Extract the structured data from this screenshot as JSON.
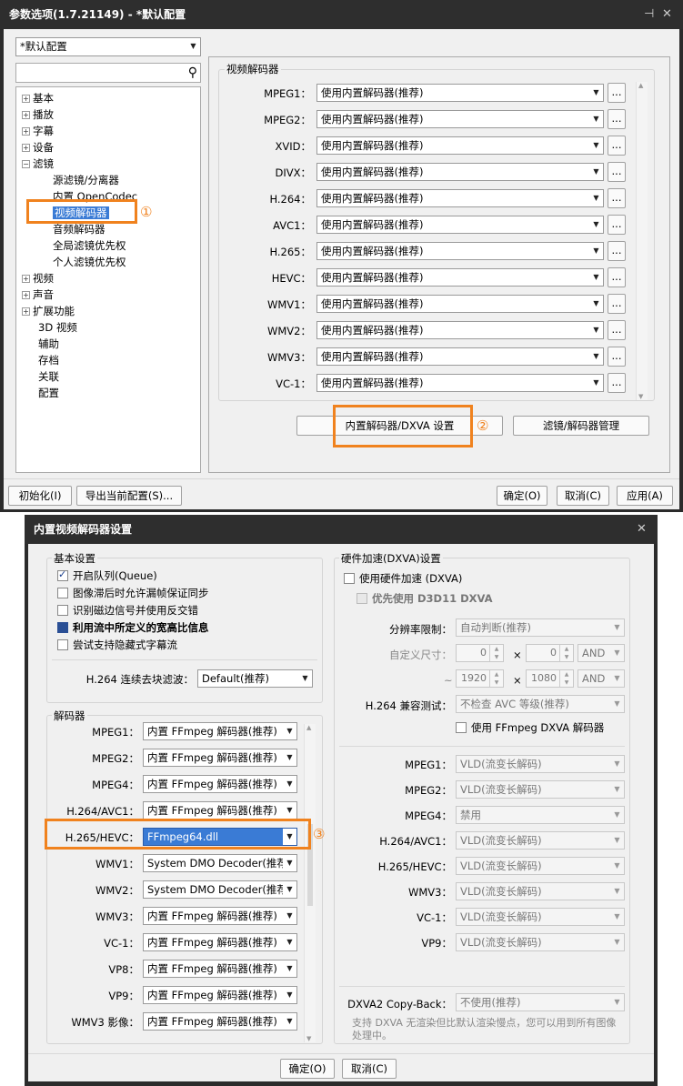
{
  "win1": {
    "title": "参数选项(1.7.21149) - *默认配置",
    "profile": "*默认配置",
    "tree": [
      {
        "label": "基本",
        "exp": "+"
      },
      {
        "label": "播放",
        "exp": "+"
      },
      {
        "label": "字幕",
        "exp": "+"
      },
      {
        "label": "设备",
        "exp": "+"
      },
      {
        "label": "滤镜",
        "exp": "-"
      },
      {
        "label": "源滤镜/分离器",
        "exp": ""
      },
      {
        "label": "内置 OpenCodec",
        "exp": ""
      },
      {
        "label": "视频解码器",
        "exp": ""
      },
      {
        "label": "音频解码器",
        "exp": ""
      },
      {
        "label": "全局滤镜优先权",
        "exp": ""
      },
      {
        "label": "个人滤镜优先权",
        "exp": ""
      },
      {
        "label": "视频",
        "exp": "+"
      },
      {
        "label": "声音",
        "exp": "+"
      },
      {
        "label": "扩展功能",
        "exp": "+"
      },
      {
        "label": "3D 视频",
        "exp": ""
      },
      {
        "label": "辅助",
        "exp": ""
      },
      {
        "label": "存档",
        "exp": ""
      },
      {
        "label": "关联",
        "exp": ""
      },
      {
        "label": "配置",
        "exp": ""
      }
    ],
    "tabs": [
      "滤镜",
      "源滤镜/分离器",
      "内置 OpenCodec",
      "视频解码器",
      "音频解码器",
      "全局滤镜"
    ],
    "group_title": "视频解码器",
    "decoders": [
      {
        "label": "MPEG1：",
        "value": "使用内置解码器(推荐)"
      },
      {
        "label": "MPEG2：",
        "value": "使用内置解码器(推荐)"
      },
      {
        "label": "XVID：",
        "value": "使用内置解码器(推荐)"
      },
      {
        "label": "DIVX：",
        "value": "使用内置解码器(推荐)"
      },
      {
        "label": "H.264：",
        "value": "使用内置解码器(推荐)"
      },
      {
        "label": "AVC1：",
        "value": "使用内置解码器(推荐)"
      },
      {
        "label": "H.265：",
        "value": "使用内置解码器(推荐)"
      },
      {
        "label": "HEVC：",
        "value": "使用内置解码器(推荐)"
      },
      {
        "label": "WMV1：",
        "value": "使用内置解码器(推荐)"
      },
      {
        "label": "WMV2：",
        "value": "使用内置解码器(推荐)"
      },
      {
        "label": "WMV3：",
        "value": "使用内置解码器(推荐)"
      },
      {
        "label": "VC-1：",
        "value": "使用内置解码器(推荐)"
      }
    ],
    "dots": "...",
    "btn_dxva": "内置解码器/DXVA 设置",
    "btn_manage": "滤镜/解码器管理",
    "btn_init": "初始化(I)",
    "btn_export": "导出当前配置(S)...",
    "btn_ok": "确定(O)",
    "btn_cancel": "取消(C)",
    "btn_apply": "应用(A)",
    "mark1": "①",
    "mark2": "②"
  },
  "win2": {
    "title": "内置视频解码器设置",
    "basic_title": "基本设置",
    "basic_items": [
      {
        "label": "开启队列(Queue)",
        "state": "on"
      },
      {
        "label": "图像滞后时允许漏帧保证同步",
        "state": "off"
      },
      {
        "label": "识别磁边信号并使用反交错",
        "state": "off"
      },
      {
        "label": "利用流中所定义的宽高比信息",
        "state": "blk"
      },
      {
        "label": "尝试支持隐藏式字幕流",
        "state": "off"
      }
    ],
    "h264_deblock_label": "H.264 连续去块滤波：",
    "h264_deblock_value": "Default(推荐)",
    "decoder_title": "解码器",
    "decoders": [
      {
        "label": "MPEG1：",
        "value": "内置 FFmpeg 解码器(推荐)"
      },
      {
        "label": "MPEG2：",
        "value": "内置 FFmpeg 解码器(推荐)"
      },
      {
        "label": "MPEG4：",
        "value": "内置 FFmpeg 解码器(推荐)"
      },
      {
        "label": "H.264/AVC1：",
        "value": "内置 FFmpeg 解码器(推荐)"
      },
      {
        "label": "H.265/HEVC：",
        "value": "FFmpeg64.dll"
      },
      {
        "label": "WMV1：",
        "value": "System DMO Decoder(推荐)"
      },
      {
        "label": "WMV2：",
        "value": "System DMO Decoder(推荐)"
      },
      {
        "label": "WMV3：",
        "value": "内置 FFmpeg 解码器(推荐)"
      },
      {
        "label": "VC-1：",
        "value": "内置 FFmpeg 解码器(推荐)"
      },
      {
        "label": "VP8：",
        "value": "内置 FFmpeg 解码器(推荐)"
      },
      {
        "label": "VP9：",
        "value": "内置 FFmpeg 解码器(推荐)"
      },
      {
        "label": "WMV3 影像：",
        "value": "内置 FFmpeg 解码器(推荐)"
      }
    ],
    "hw_title": "硬件加速(DXVA)设置",
    "hw_use": "使用硬件加速 (DXVA)",
    "hw_d3d11": "优先使用 D3D11 DXVA",
    "res_label": "分辨率限制：",
    "res_value": "自动判断(推荐)",
    "custom_label": "自定义尺寸：",
    "w1": "0",
    "h1": "0",
    "and1": "AND",
    "tilde": "~",
    "times": "×",
    "w2": "1920",
    "h2": "1080",
    "and2": "AND",
    "h264test_label": "H.264 兼容测试：",
    "h264test_value": "不检查 AVC 等级(推荐)",
    "ffdxva": "使用 FFmpeg DXVA 解码器",
    "hw_decoders": [
      {
        "label": "MPEG1：",
        "value": "VLD(流变长解码)"
      },
      {
        "label": "MPEG2：",
        "value": "VLD(流变长解码)"
      },
      {
        "label": "MPEG4：",
        "value": "禁用"
      },
      {
        "label": "H.264/AVC1：",
        "value": "VLD(流变长解码)"
      },
      {
        "label": "H.265/HEVC：",
        "value": "VLD(流变长解码)"
      },
      {
        "label": "WMV3：",
        "value": "VLD(流变长解码)"
      },
      {
        "label": "VC-1：",
        "value": "VLD(流变长解码)"
      },
      {
        "label": "VP9：",
        "value": "VLD(流变长解码)"
      }
    ],
    "copyback_label": "DXVA2 Copy-Back：",
    "copyback_value": "不使用(推荐)",
    "note": "支持 DXVA 无渲染但比默认渲染慢点，您可以用到所有图像处理中。",
    "btn_ok": "确定(O)",
    "btn_cancel": "取消(C)",
    "mark3": "③"
  }
}
